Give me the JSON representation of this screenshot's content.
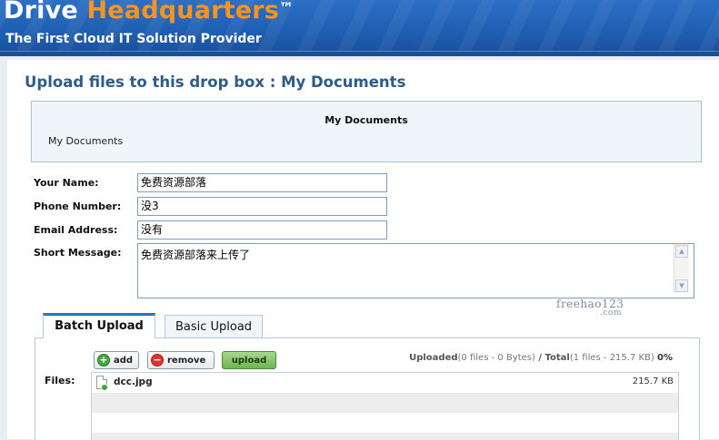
{
  "header": {
    "brand_part1": "Drive ",
    "brand_part2": "Headquarters",
    "brand_tm": "™",
    "tagline": "The First Cloud IT Solution Provider",
    "colors": {
      "header_blue": "#2563b0",
      "brand_orange": "#f7941d"
    }
  },
  "page": {
    "title": "Upload files to this drop box :  My Documents"
  },
  "dropbox_info": {
    "name": "My Documents",
    "description": "My Documents"
  },
  "form": {
    "name_label": "Your Name:",
    "name_value": "免费资源部落",
    "phone_label": "Phone Number:",
    "phone_value": "没3",
    "email_label": "Email Address:",
    "email_value": "没有",
    "message_label": "Short Message:",
    "message_value": "免费资源部落来上传了"
  },
  "watermark": {
    "text": "freehao123",
    "sub": ".com"
  },
  "tabs": [
    {
      "label": "Batch Upload",
      "active": true
    },
    {
      "label": "Basic Upload",
      "active": false
    }
  ],
  "toolbar": {
    "add_label": "add",
    "remove_label": "remove",
    "upload_label": "upload"
  },
  "status": {
    "uploaded_label": "Uploaded",
    "uploaded_detail": "(0 files - 0 Bytes)",
    "separator": " / ",
    "total_label": "Total",
    "total_detail": "(1 files - 215.7 KB)",
    "percent": "0%"
  },
  "files": {
    "label": "Files:",
    "items": [
      {
        "name": "dcc.jpg",
        "size": "215.7 KB",
        "icon": "image-file-icon"
      }
    ]
  }
}
